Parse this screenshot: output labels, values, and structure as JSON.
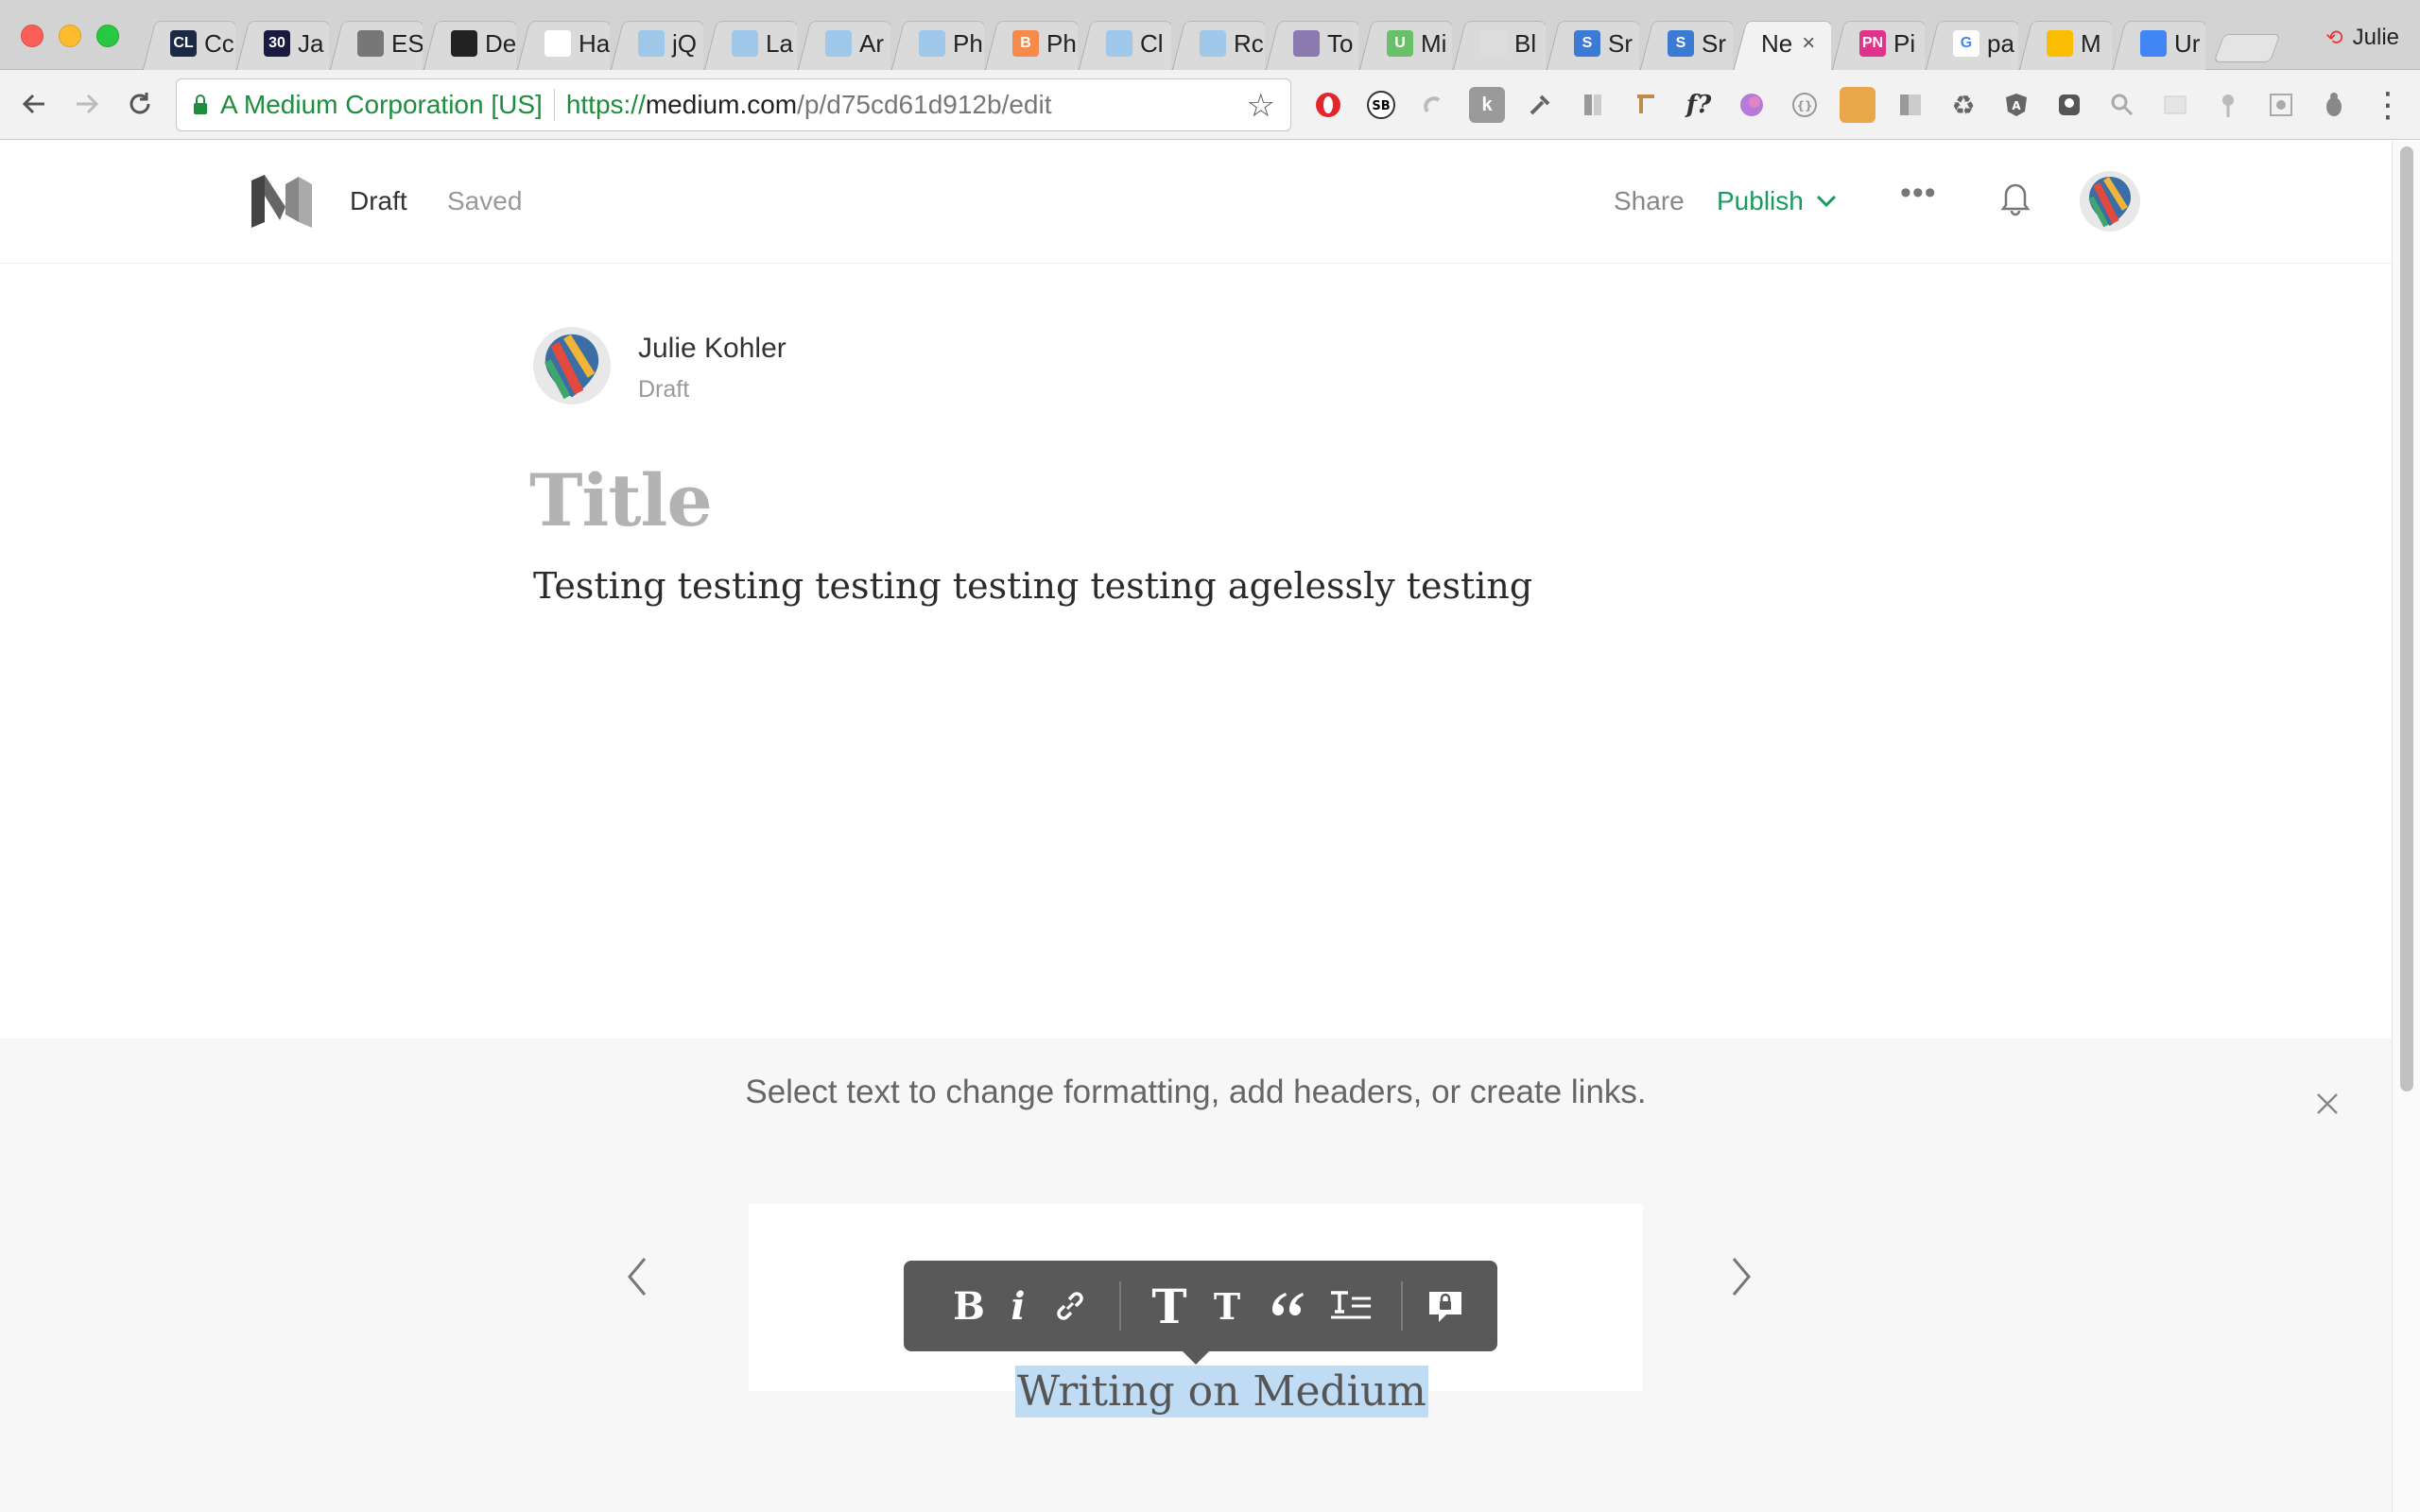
{
  "browser": {
    "tabs": [
      {
        "label": "Cc",
        "icon": "cl-icon",
        "color": "#1a2a44",
        "glyph": "CL"
      },
      {
        "label": "Ja",
        "icon": "30-icon",
        "color": "#1a1a40",
        "glyph": "30"
      },
      {
        "label": "ES",
        "icon": "es-icon",
        "color": "#777",
        "glyph": ""
      },
      {
        "label": "De",
        "icon": "github-icon",
        "color": "#222",
        "glyph": ""
      },
      {
        "label": "Ha",
        "icon": "hackerrank-icon",
        "color": "#fff",
        "glyph": ""
      },
      {
        "label": "jQ",
        "icon": "gradient-icon",
        "color": "#9fc8ea",
        "glyph": ""
      },
      {
        "label": "La",
        "icon": "gradient-icon",
        "color": "#9fc8ea",
        "glyph": ""
      },
      {
        "label": "Ar",
        "icon": "gradient-icon",
        "color": "#9fc8ea",
        "glyph": ""
      },
      {
        "label": "Ph",
        "icon": "gradient-icon",
        "color": "#9fc8ea",
        "glyph": ""
      },
      {
        "label": "Ph",
        "icon": "blogger-icon",
        "color": "#f58a4b",
        "glyph": "B"
      },
      {
        "label": "Cl",
        "icon": "gradient-icon",
        "color": "#9fc8ea",
        "glyph": ""
      },
      {
        "label": "Rc",
        "icon": "gradient-icon",
        "color": "#9fc8ea",
        "glyph": ""
      },
      {
        "label": "To",
        "icon": "colorlib-icon",
        "color": "#8a7ab0",
        "glyph": ""
      },
      {
        "label": "Mi",
        "icon": "u-icon",
        "color": "#6abf69",
        "glyph": "U"
      },
      {
        "label": "Bl",
        "icon": "page-icon",
        "color": "#ddd",
        "glyph": ""
      },
      {
        "label": "Sr",
        "icon": "s-icon",
        "color": "#3b7bd4",
        "glyph": "S"
      },
      {
        "label": "Sr",
        "icon": "s-icon",
        "color": "#3b7bd4",
        "glyph": "S"
      },
      {
        "label": "Ne",
        "icon": "",
        "color": "",
        "glyph": "",
        "active": true
      },
      {
        "label": "Pi",
        "icon": "pn-icon",
        "color": "#e0348a",
        "glyph": "PN"
      },
      {
        "label": "pa",
        "icon": "google-icon",
        "color": "#fff",
        "glyph": "G"
      },
      {
        "label": "M",
        "icon": "drive-icon",
        "color": "#fbbc04",
        "glyph": ""
      },
      {
        "label": "Ur",
        "icon": "docs-icon",
        "color": "#4285f4",
        "glyph": ""
      }
    ],
    "profile_name": "Julie",
    "ev_name": "A Medium Corporation [US]",
    "url_scheme": "https://",
    "url_host": "medium.com",
    "url_path": "/p/d75cd61d912b/edit"
  },
  "header": {
    "status": "Draft",
    "save_state": "Saved",
    "share_label": "Share",
    "publish_label": "Publish",
    "more_label": "•••"
  },
  "author": {
    "name": "Julie Kohler",
    "status": "Draft"
  },
  "post": {
    "title_placeholder": "Title",
    "body": "Testing testing testing testing testing agelessly testing"
  },
  "tip": {
    "text": "Select text to change formatting, add headers, or create links.",
    "sample_text": "Writing on Medium"
  },
  "format_toolbar": {
    "bold": "B",
    "italic": "i",
    "large_heading": "T",
    "small_heading": "T"
  },
  "colors": {
    "publish_green": "#1a9a5e",
    "toolbar_bg": "#595959",
    "selection": "#bfdcf4",
    "secure_green": "#1e8e3e"
  }
}
